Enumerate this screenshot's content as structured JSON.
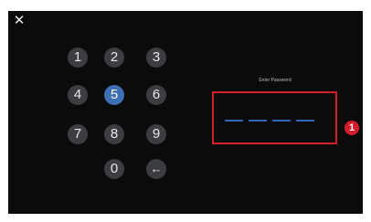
{
  "header": {
    "close_glyph": "✕"
  },
  "keypad": {
    "keys": [
      "1",
      "2",
      "3",
      "4",
      "5",
      "6",
      "7",
      "8",
      "9",
      "0",
      "←"
    ],
    "selected_key": "5"
  },
  "password": {
    "label": "Enter Password",
    "slot_count": 4
  },
  "annotation": {
    "marker": "1"
  },
  "colors": {
    "screen_bg": "#0b0b0c",
    "key_bg": "#3b3d40",
    "key_selected": "#3f6fb3",
    "highlight_red": "#d31f2b",
    "slot_blue": "#2f67b7"
  },
  "icons": [
    "close-icon",
    "backspace-arrow-icon"
  ]
}
